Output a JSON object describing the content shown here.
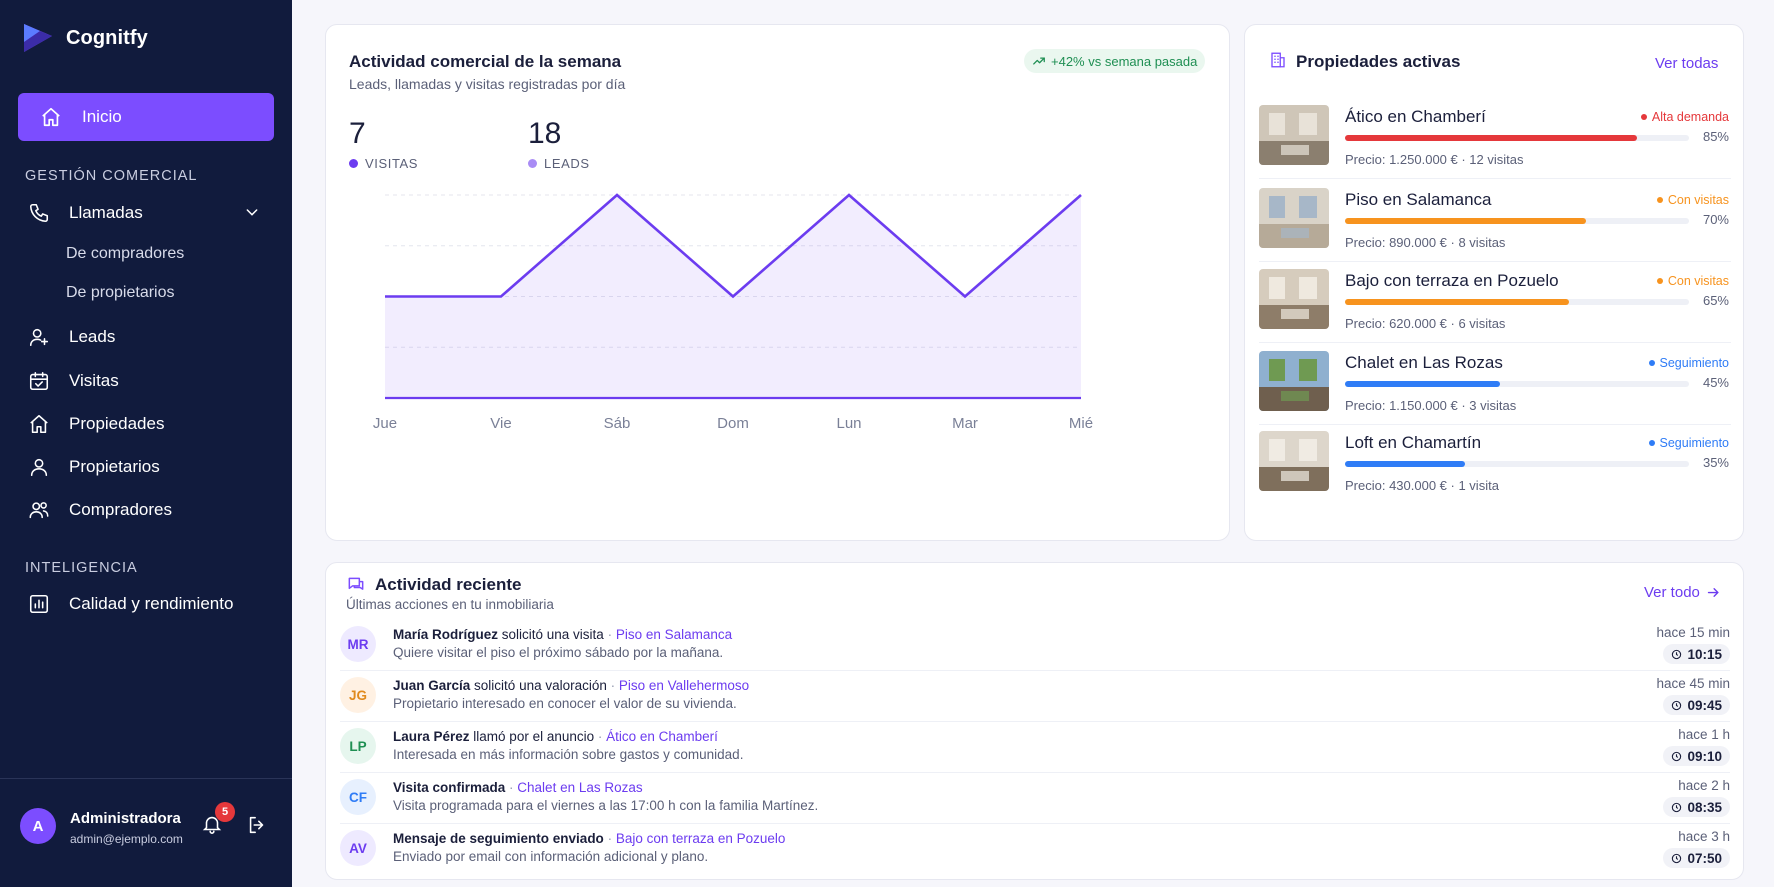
{
  "brand": {
    "name": "Cognitfy"
  },
  "nav": {
    "active": {
      "label": "Inicio",
      "icon": "home-icon"
    },
    "section1": "GESTIÓN COMERCIAL",
    "calls": {
      "label": "Llamadas",
      "sub": [
        "De compradores",
        "De propietarios"
      ]
    },
    "items": [
      {
        "label": "Leads",
        "icon": "user-plus-icon"
      },
      {
        "label": "Visitas",
        "icon": "calendar-check-icon"
      },
      {
        "label": "Propiedades",
        "icon": "home-icon"
      },
      {
        "label": "Propietarios",
        "icon": "user-icon"
      },
      {
        "label": "Compradores",
        "icon": "users-icon"
      }
    ],
    "section2": "INTELIGENCIA",
    "quality": {
      "label": "Calidad y rendimiento",
      "icon": "bar-chart-icon"
    }
  },
  "user": {
    "initial": "A",
    "name": "Administradora",
    "email": "admin@ejemplo.com",
    "notifications": "5"
  },
  "activity_chart": {
    "title": "Actividad comercial de la semana",
    "subtitle": "Leads, llamadas y visitas registradas por día",
    "trend": "+42% vs semana pasada",
    "stats": [
      {
        "value": "7",
        "label": "VISITAS",
        "color": "#6c3cf0"
      },
      {
        "value": "18",
        "label": "LEADS",
        "color": "#a98cf5"
      }
    ]
  },
  "chart_data": {
    "type": "area",
    "categories": [
      "Jue",
      "Vie",
      "Sáb",
      "Dom",
      "Lun",
      "Mar",
      "Mié"
    ],
    "series": [
      {
        "values": [
          1,
          1,
          2,
          1,
          2,
          1,
          2
        ],
        "color": "#6c3cf0"
      }
    ],
    "ylim": [
      0,
      2
    ],
    "grid": true
  },
  "properties": {
    "title": "Propiedades activas",
    "view_all": "Ver todas",
    "items": [
      {
        "name": "Ático en Chamberí",
        "status": "Alta demanda",
        "status_color": "#e5383b",
        "progress": 85,
        "pct": "85%",
        "price": "Precio: 1.250.000 € · 12 visitas"
      },
      {
        "name": "Piso en Salamanca",
        "status": "Con visitas",
        "status_color": "#f7931e",
        "progress": 70,
        "pct": "70%",
        "price": "Precio: 890.000 € · 8 visitas"
      },
      {
        "name": "Bajo con terraza en Pozuelo",
        "status": "Con visitas",
        "status_color": "#f7931e",
        "progress": 65,
        "pct": "65%",
        "price": "Precio: 620.000 € · 6 visitas"
      },
      {
        "name": "Chalet en Las Rozas",
        "status": "Seguimiento",
        "status_color": "#2f7cf6",
        "progress": 45,
        "pct": "45%",
        "price": "Precio: 1.150.000 € · 3 visitas"
      },
      {
        "name": "Loft en Chamartín",
        "status": "Seguimiento",
        "status_color": "#2f7cf6",
        "progress": 35,
        "pct": "35%",
        "price": "Precio: 430.000 € · 1 visita"
      }
    ]
  },
  "recent": {
    "title": "Actividad reciente",
    "subtitle": "Últimas acciones en tu inmobiliaria",
    "view_all": "Ver todo",
    "items": [
      {
        "initials": "MR",
        "av_bg": "#eeeaff",
        "av_fg": "#6c3cf0",
        "who": "María Rodríguez",
        "action": " solicitó una visita",
        "sep": " · ",
        "link": "Piso en Salamanca",
        "detail": "Quiere visitar el piso el próximo sábado por la mañana.",
        "ago": "hace 15 min",
        "time": "10:15"
      },
      {
        "initials": "JG",
        "av_bg": "#fff1e3",
        "av_fg": "#e08a1e",
        "who": "Juan García",
        "action": " solicitó una valoración",
        "sep": " · ",
        "link": "Piso en Vallehermoso",
        "detail": "Propietario interesado en conocer el valor de su vivienda.",
        "ago": "hace 45 min",
        "time": "09:45"
      },
      {
        "initials": "LP",
        "av_bg": "#e6f6ee",
        "av_fg": "#1f8f53",
        "who": "Laura Pérez",
        "action": " llamó por el anuncio",
        "sep": " · ",
        "link": "Ático en Chamberí",
        "detail": "Interesada en más información sobre gastos y comunidad.",
        "ago": "hace 1 h",
        "time": "09:10"
      },
      {
        "initials": "CF",
        "av_bg": "#e7f0fe",
        "av_fg": "#2f7cf6",
        "who": "Visita confirmada",
        "action": "",
        "sep": " · ",
        "link": "Chalet en Las Rozas",
        "detail": "Visita programada para el viernes a las 17:00 h con la familia Martínez.",
        "ago": "hace 2 h",
        "time": "08:35"
      },
      {
        "initials": "AV",
        "av_bg": "#eeeaff",
        "av_fg": "#6c3cf0",
        "who": "Mensaje de seguimiento enviado",
        "action": "",
        "sep": " · ",
        "link": "Bajo con terraza en Pozuelo",
        "detail": "Enviado por email con información adicional y plano.",
        "ago": "hace 3 h",
        "time": "07:50"
      }
    ]
  }
}
